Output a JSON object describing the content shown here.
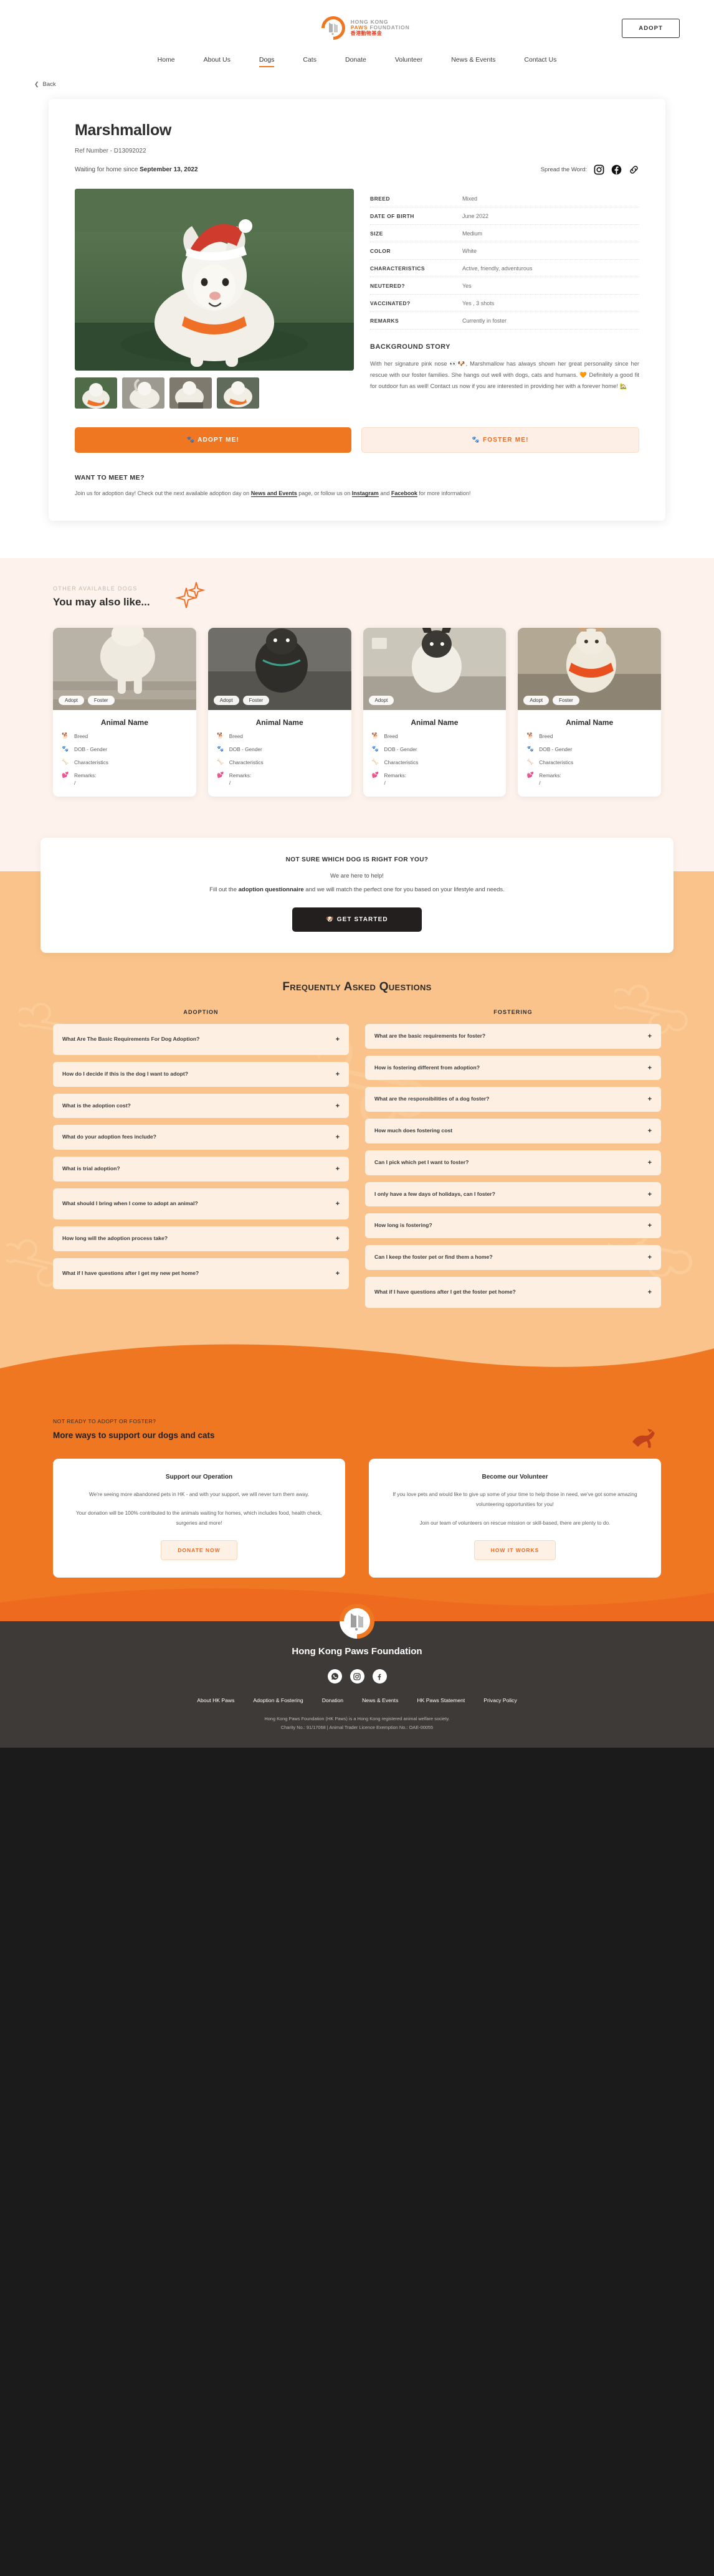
{
  "header": {
    "logo": {
      "line1": "HONG KONG",
      "line2_accent": "PAWS",
      "line2_rest": "FOUNDATION",
      "line3": "香港動物基金"
    },
    "adopt_button": "ADOPT",
    "nav": [
      {
        "label": "Home",
        "active": false
      },
      {
        "label": "About Us",
        "active": false
      },
      {
        "label": "Dogs",
        "active": true
      },
      {
        "label": "Cats",
        "active": false
      },
      {
        "label": "Donate",
        "active": false
      },
      {
        "label": "Volunteer",
        "active": false
      },
      {
        "label": "News & Events",
        "active": false
      },
      {
        "label": "Contact Us",
        "active": false
      }
    ],
    "back_label": "Back"
  },
  "profile": {
    "name": "Marshmallow",
    "ref_number": "Ref Number - D13092022",
    "waiting_prefix": "Waiting for home since ",
    "waiting_date": "September 13, 2022",
    "spread_label": "Spread the Word:",
    "attributes": [
      {
        "key": "BREED",
        "value": "Mixed"
      },
      {
        "key": "DATE OF BIRTH",
        "value": "June 2022"
      },
      {
        "key": "SIZE",
        "value": "Medium"
      },
      {
        "key": "COLOR",
        "value": "White"
      },
      {
        "key": "CHARACTERISTICS",
        "value": "Active, friendly, adventurous"
      },
      {
        "key": "NEUTERED?",
        "value": "Yes"
      },
      {
        "key": "VACCINATED?",
        "value": "Yes , 3 shots"
      },
      {
        "key": "REMARKS",
        "value": "Currently in foster"
      }
    ],
    "background_title": "BACKGROUND STORY",
    "background_body": "With her signature pink nose 👀🐶, Marshmallow has always shown her great personality since her rescue with our foster families. She hangs out well with dogs, cats and humans. 🧡 Definitely a good fit for outdoor fun as well! Contact us now if you are interested in providing her with a forever home! 🏡",
    "adopt_button": "🐾 ADOPT ME!",
    "foster_button": "🐾 FOSTER ME!",
    "meet_title": "WANT TO MEET ME?",
    "meet_text_1": "Join us for adoption day! Check out the next available adoption day on ",
    "meet_link_1": "News and Events",
    "meet_text_2": " page, or follow us on ",
    "meet_link_2": "Instagram",
    "meet_text_3": " and ",
    "meet_link_3": "Facebook",
    "meet_text_4": " for more information!"
  },
  "other_dogs": {
    "kicker": "OTHER AVAILABLE DOGS",
    "title": "You may also like...",
    "card_template": {
      "name": "Animal Name",
      "breed": "Breed",
      "dob_gender": "DOB - Gender",
      "characteristics": "Characteristics",
      "remarks": "Remarks:",
      "remarks_value": "/",
      "pill_adopt": "Adopt",
      "pill_foster": "Foster"
    },
    "cards": [
      {
        "name": "Animal Name",
        "breed": "Breed",
        "dob_gender": "DOB - Gender",
        "characteristics": "Characteristics",
        "remarks": "Remarks:",
        "remarks_value": "/",
        "pills": [
          "Adopt",
          "Foster"
        ],
        "img_a": "#cfc7bc",
        "img_b": "#8e8376"
      },
      {
        "name": "Animal Name",
        "breed": "Breed",
        "dob_gender": "DOB - Gender",
        "characteristics": "Characteristics",
        "remarks": "Remarks:",
        "remarks_value": "/",
        "pills": [
          "Adopt",
          "Foster"
        ],
        "img_a": "#6e6d68",
        "img_b": "#36352f"
      },
      {
        "name": "Animal Name",
        "breed": "Breed",
        "dob_gender": "DOB - Gender",
        "characteristics": "Characteristics",
        "remarks": "Remarks:",
        "remarks_value": "/",
        "pills": [
          "Adopt"
        ],
        "img_a": "#b9b2a4",
        "img_b": "#5d5a50"
      },
      {
        "name": "Animal Name",
        "breed": "Breed",
        "dob_gender": "DOB - Gender",
        "characteristics": "Characteristics",
        "remarks": "Remarks:",
        "remarks_value": "/",
        "pills": [
          "Adopt",
          "Foster"
        ],
        "img_a": "#a89b86",
        "img_b": "#6c6253"
      }
    ]
  },
  "questionnaire": {
    "heading": "NOT SURE WHICH DOG IS RIGHT FOR YOU?",
    "subheading": "We are here to help!",
    "line_prefix": "Fill out the ",
    "line_bold": "adoption questionnaire",
    "line_suffix": " and we will match the perfect one for you based on your lifestyle and needs.",
    "button": "🐶 GET STARTED"
  },
  "faq": {
    "title": "Frequently Asked Questions",
    "columns": [
      {
        "heading": "ADOPTION",
        "items": [
          "What Are The Basic Requirements For Dog Adoption?",
          "How do I decide if this is the dog I want to adopt?",
          "What is the adoption cost?",
          "What do your adoption fees include?",
          "What is trial adoption?",
          "What should I bring when I come to adopt an animal?",
          "How long will the adoption process take?",
          "What if I have questions after I get my new pet home?"
        ]
      },
      {
        "heading": "FOSTERING",
        "items": [
          "What are the basic requirements for foster?",
          "How is fostering different from adoption?",
          "What are the responsibilities of a dog foster?",
          "How much does fostering cost",
          "Can I pick which pet I want to foster?",
          "I only have a few days of holidays, can I foster?",
          "How long is fostering?",
          "Can I keep the foster pet or find them a home?",
          "What if I have questions after I get the foster pet home?"
        ]
      }
    ],
    "expand_icon": "+"
  },
  "support": {
    "kicker": "NOT READY TO ADOPT OR FOSTER?",
    "title": "More ways to support our dogs and cats",
    "cards": [
      {
        "heading": "Support our Operation",
        "paragraph_1": "We're seeing more abandoned pets in HK - and with your support, we will never turn them away.",
        "paragraph_2": "Your donation will be 100% contributed to the animals waiting for homes, which includes food, health check, surgeries and more!",
        "button": "DONATE NOW"
      },
      {
        "heading": "Become our Volunteer",
        "paragraph_1": "If you love pets and would like to give up some of your time to help those in need, we've got some amazing volunteering opportunities for you!",
        "paragraph_2": "Join our team of volunteers on rescue mission or skill-based, there are plenty to do.",
        "button": "HOW IT WORKS"
      }
    ]
  },
  "footer": {
    "org_name": "Hong Kong Paws Foundation",
    "social": [
      "whatsapp-icon",
      "instagram-icon",
      "facebook-icon"
    ],
    "links": [
      "About HK Paws",
      "Adoption & Fostering",
      "Donation",
      "News & Events",
      "HK Paws Statement",
      "Privacy Policy"
    ],
    "legal_line_1": "Hong Kong Paws Foundation (HK Paws) is a Hong Kong registered animal welfare society.",
    "legal_line_2": "Charity No.: 91/17068     |     Animal Trader Licence Exemption No.: OAE-00055"
  },
  "colors": {
    "accent": "#f07722",
    "accent_dark": "#e23b1e",
    "faq_bg": "#fac38b",
    "card_bg": "#fdefe1",
    "cream": "#fdf3ec",
    "footer_bg": "#3d3a38",
    "dark_button": "#231f1e"
  }
}
